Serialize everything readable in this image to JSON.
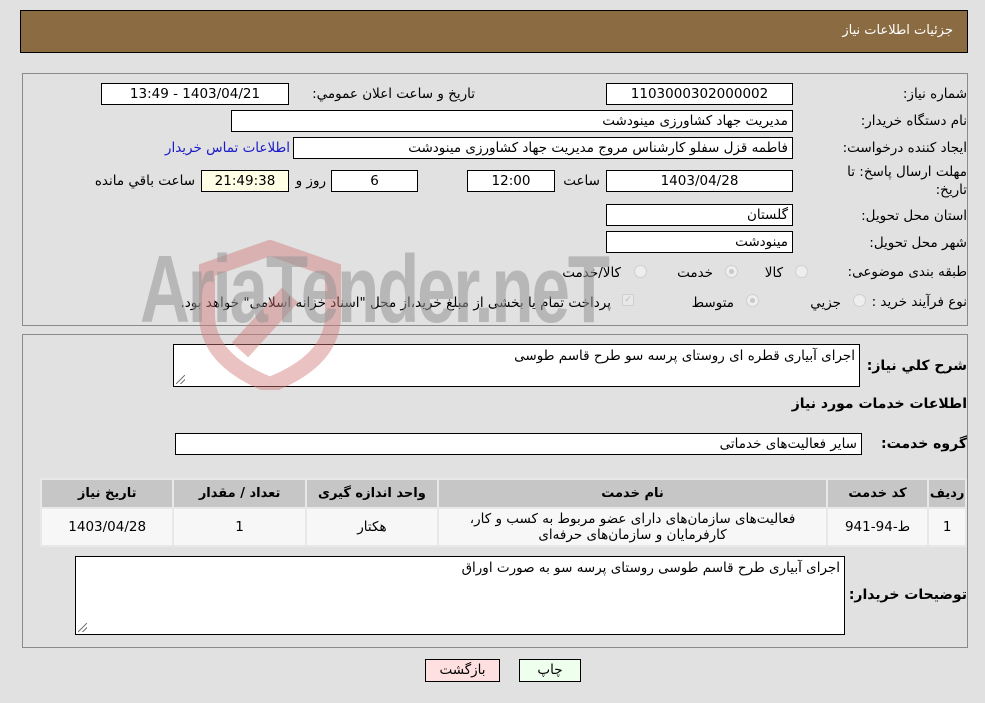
{
  "header": {
    "title": "جزئیات اطلاعات نیاز"
  },
  "form": {
    "need_number": {
      "label": "شماره نیاز:",
      "value": "1103000302000002"
    },
    "announce_datetime": {
      "label": "تاریخ و ساعت اعلان عمومي:",
      "value": "1403/04/21 - 13:49"
    },
    "buyer_org": {
      "label": "نام دستگاه خريدار:",
      "value": "مدیریت جهاد کشاورزی مینودشت"
    },
    "requester": {
      "label": "ایجاد کننده درخواست:",
      "value": "فاطمه قزل سفلو کارشناس مروج مدیریت جهاد کشاورزی مینودشت"
    },
    "buyer_contact_link": "اطلاعات تماس خریدار",
    "deadline": {
      "label_line1": "مهلت ارسال پاسخ: تا",
      "label_line2": "تاریخ:",
      "date": "1403/04/28",
      "time_label": "ساعت",
      "time": "12:00",
      "days": "6",
      "days_label": "روز و",
      "remaining": "21:49:38",
      "remaining_label": "ساعت باقي مانده"
    },
    "province": {
      "label": "استان محل تحویل:",
      "value": "گلستان"
    },
    "city": {
      "label": "شهر محل تحویل:",
      "value": "مینودشت"
    },
    "category": {
      "label": "طبقه بندی موضوعی:",
      "options": [
        "کالا",
        "خدمت",
        "کالا/خدمت"
      ],
      "selected": "خدمت"
    },
    "purchase_type": {
      "label": "نوع فرآیند خرید :",
      "options": [
        "جزيي",
        "متوسط"
      ],
      "selected": "متوسط",
      "treasury_note": "پرداخت تمام یا بخشی از مبلغ خرید،از محل \"اسناد خزانه اسلامی\" خواهد بود.",
      "treasury_checked": true
    }
  },
  "details": {
    "summary_label": "شرح کلي نياز:",
    "summary_value": "اجرای آبیاری قطره ای روستای پرسه سو طرح قاسم طوسی",
    "services_heading": "اطلاعات خدمات مورد نیاز",
    "service_group_label": "گروه خدمت:",
    "service_group_value": "سایر فعالیت‌های خدماتی",
    "table": {
      "columns": [
        "ردیف",
        "کد خدمت",
        "نام خدمت",
        "واحد اندازه گیری",
        "تعداد / مقدار",
        "تاریخ نیاز"
      ],
      "rows": [
        {
          "row": "1",
          "code": "ط-94-941",
          "name_line1": "فعالیت‌های سازمان‌های دارای عضو مربوط به کسب و کار،",
          "name_line2": "کارفرمایان و سازمان‌های حرفه‌ای",
          "unit": "هکتار",
          "quantity": "1",
          "date": "1403/04/28"
        }
      ]
    },
    "buyer_notes_label": "توضیحات خریدار:",
    "buyer_notes_value": "اجرای آبیاری طرح قاسم طوسی روستای پرسه سو به صورت اوراق"
  },
  "buttons": {
    "print": "چاپ",
    "back": "بازگشت"
  },
  "watermark": {
    "text": "AriaTender.neT"
  }
}
